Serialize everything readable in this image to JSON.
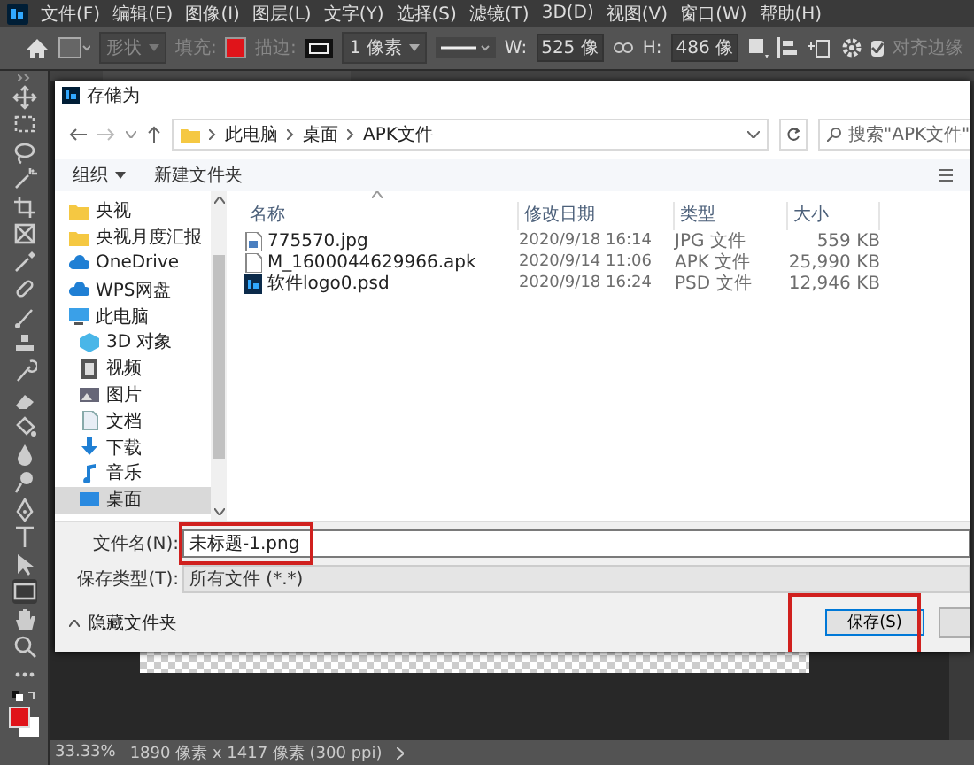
{
  "menus": [
    "文件(F)",
    "编辑(E)",
    "图像(I)",
    "图层(L)",
    "文字(Y)",
    "选择(S)",
    "滤镜(T)",
    "3D(D)",
    "视图(V)",
    "窗口(W)",
    "帮助(H)"
  ],
  "options": {
    "mode": "形状",
    "fill_label": "填充:",
    "stroke_label": "描边:",
    "stroke_width": "1 像素",
    "w_label": "W:",
    "w_value": "525 像",
    "h_label": "H:",
    "h_value": "486 像",
    "align_edges": {
      "label": "对齐边缘",
      "checked": true
    }
  },
  "dialog": {
    "title": "存储为",
    "breadcrumb": [
      "此电脑",
      "桌面",
      "APK文件"
    ],
    "search": {
      "placeholder": "搜索\"APK文件\""
    },
    "organize": "组织",
    "new_folder": "新建文件夹",
    "nav": [
      {
        "label": "央视",
        "kind": "folder",
        "selected": false
      },
      {
        "label": "央视月度汇报",
        "kind": "folder",
        "selected": false
      },
      {
        "label": "OneDrive",
        "kind": "cloud",
        "selected": false
      },
      {
        "label": "WPS网盘",
        "kind": "cloud",
        "selected": false
      },
      {
        "label": "此电脑",
        "kind": "pc",
        "selected": false,
        "children": [
          {
            "label": "3D 对象",
            "kind": "cube",
            "selected": false
          },
          {
            "label": "视频",
            "kind": "video",
            "selected": false
          },
          {
            "label": "图片",
            "kind": "picture",
            "selected": false
          },
          {
            "label": "文档",
            "kind": "doc",
            "selected": false
          },
          {
            "label": "下载",
            "kind": "download",
            "selected": false
          },
          {
            "label": "音乐",
            "kind": "music",
            "selected": false
          },
          {
            "label": "桌面",
            "kind": "desktop",
            "selected": true
          }
        ]
      }
    ],
    "columns": [
      "名称",
      "修改日期",
      "类型",
      "大小"
    ],
    "files": [
      {
        "name": "775570.jpg",
        "date": "2020/9/18 16:14",
        "type": "JPG 文件",
        "size": "559 KB",
        "kind": "image"
      },
      {
        "name": "M_1600044629966.apk",
        "date": "2020/9/14 11:06",
        "type": "APK 文件",
        "size": "25,990 KB",
        "kind": "file"
      },
      {
        "name": "软件logo0.psd",
        "date": "2020/9/18 16:24",
        "type": "PSD 文件",
        "size": "12,946 KB",
        "kind": "psd"
      }
    ],
    "filename": {
      "label": "文件名(N):",
      "value": "未标题-1.png",
      "highlighted": true
    },
    "filetype": {
      "label": "保存类型(T):",
      "value": "所有文件 (*.*)"
    },
    "hide_folders": "隐藏文件夹",
    "save_button": {
      "label": "保存(S)",
      "highlighted": true
    }
  },
  "status": {
    "zoom": "33.33%",
    "info": "1890 像素 x 1417 像素 (300 ppi)"
  }
}
